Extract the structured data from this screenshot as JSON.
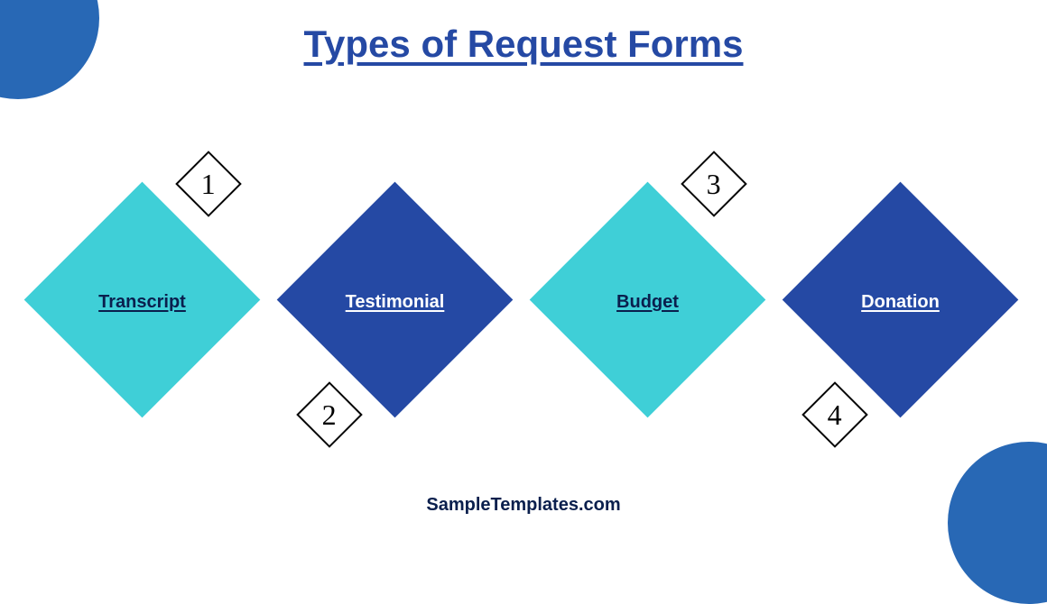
{
  "title": "Types of Request Forms",
  "footer": "SampleTemplates.com",
  "colors": {
    "teal": "#3fcfd7",
    "navy": "#2549a4",
    "accent": "#2868b5",
    "title": "#2549a4",
    "footer": "#0a1f4d"
  },
  "items": [
    {
      "num": "1",
      "label": "Transcript",
      "bg": "teal",
      "labelClass": "label-dark",
      "numPos": "top"
    },
    {
      "num": "2",
      "label": "Testimonial",
      "bg": "navy",
      "labelClass": "label-light",
      "numPos": "bottom"
    },
    {
      "num": "3",
      "label": "Budget",
      "bg": "teal",
      "labelClass": "label-dark",
      "numPos": "top"
    },
    {
      "num": "4",
      "label": "Donation",
      "bg": "navy",
      "labelClass": "label-light",
      "numPos": "bottom"
    }
  ]
}
